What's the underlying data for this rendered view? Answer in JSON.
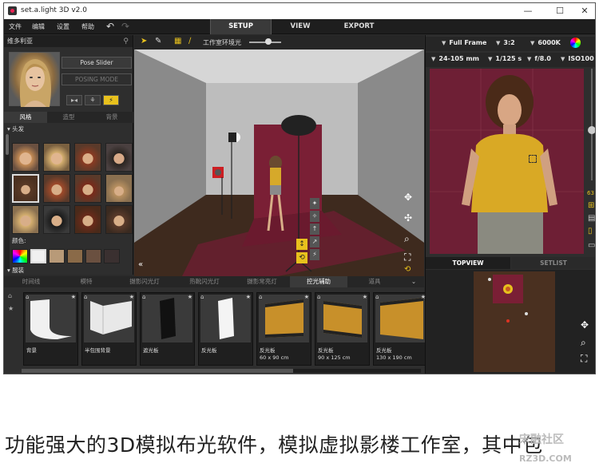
{
  "window": {
    "title": "set.a.light 3D v2.0",
    "minimize": "—",
    "maximize": "☐",
    "close": "✕"
  },
  "menu": {
    "items": [
      "文件",
      "编辑",
      "设置",
      "帮助"
    ],
    "undo": "↶",
    "redo": "↷"
  },
  "main_tabs": [
    "SETUP",
    "VIEW",
    "EXPORT"
  ],
  "model_panel": {
    "name": "维多利亚",
    "pin": "📌",
    "pose_slider": "Pose Slider",
    "posing_mode": "POSING MODE",
    "sub_tabs": [
      "风格",
      "造型",
      "背景"
    ],
    "section_hair": "头发",
    "color_label": "颜色:",
    "section_clothing": "服装"
  },
  "viewport": {
    "env_light_label": "工作室环境光",
    "collapse": "«"
  },
  "camera": {
    "frame": "Full Frame",
    "aspect": "3:2",
    "kelvin": "6000K",
    "lens": "24-105 mm",
    "shutter": "1/125 s",
    "aperture": "f/8.0",
    "iso": "ISO100",
    "zoom_value": "63"
  },
  "right_tabs": [
    "TOPVIEW",
    "SETLIST"
  ],
  "library_tabs": [
    "时间线",
    "模特",
    "摄影闪光灯",
    "热靴闪光灯",
    "摄影常亮灯",
    "控光辅助",
    "道具"
  ],
  "library_items": [
    {
      "label": "背景",
      "size": ""
    },
    {
      "label": "半包围背景",
      "size": ""
    },
    {
      "label": "遮光板",
      "size": ""
    },
    {
      "label": "反光板",
      "size": ""
    },
    {
      "label": "反光板",
      "size": "60 x 90 cm"
    },
    {
      "label": "反光板",
      "size": "90 x 125 cm"
    },
    {
      "label": "反光板",
      "size": "130 x 190 cm"
    }
  ],
  "caption": "功能强大的3D模拟布光软件，模拟虚拟影楼工作室，其中包",
  "watermark": {
    "site": "宋融社区",
    "url": "RZ3D.COM"
  },
  "colors": {
    "accent_yellow": "#e8c11d",
    "backdrop": "#7a1f35",
    "floor": "#3e2a1e"
  }
}
